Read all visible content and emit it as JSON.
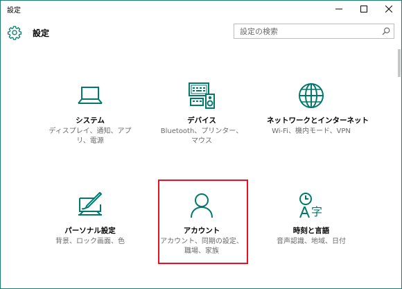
{
  "window": {
    "title": "設定",
    "minimize_glyph": "─",
    "maximize_glyph": "☐",
    "close_glyph": "✕"
  },
  "header": {
    "title": "設定",
    "icon": "gear-icon"
  },
  "search": {
    "placeholder": "設定の検索",
    "value": "",
    "icon": "search-icon"
  },
  "accent_color": "#00796b",
  "highlight_color": "#e81123",
  "tiles": [
    {
      "name": "システム",
      "desc": "ディスプレイ、通知、アプリ、電源",
      "icon": "laptop-icon"
    },
    {
      "name": "デバイス",
      "desc": "Bluetooth、プリンター、マウス",
      "icon": "devices-icon"
    },
    {
      "name": "ネットワークとインターネット",
      "desc": "Wi-Fi、機内モード、VPN",
      "icon": "globe-icon"
    },
    {
      "name": "パーソナル設定",
      "desc": "背景、ロック画面、色",
      "icon": "personalization-icon"
    },
    {
      "name": "アカウント",
      "desc": "アカウント、同期の設定、職場、家族",
      "icon": "account-icon",
      "highlighted": true
    },
    {
      "name": "時刻と言語",
      "desc": "音声認識、地域、日付",
      "icon": "time-language-icon"
    }
  ]
}
